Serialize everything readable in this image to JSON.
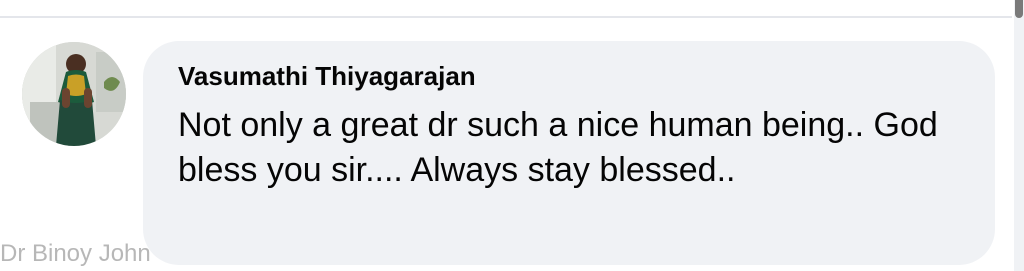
{
  "comment": {
    "author": "Vasumathi Thiyagarajan",
    "text": "Not only a great dr such a nice human being.. God bless you sir.... Always stay blessed..",
    "avatar": "profile-photo-icon"
  },
  "watermark": "Dr Binoy John",
  "colors": {
    "bubble_background": "#f0f2f5",
    "text": "#050505",
    "watermark": "#b7b7b7"
  }
}
